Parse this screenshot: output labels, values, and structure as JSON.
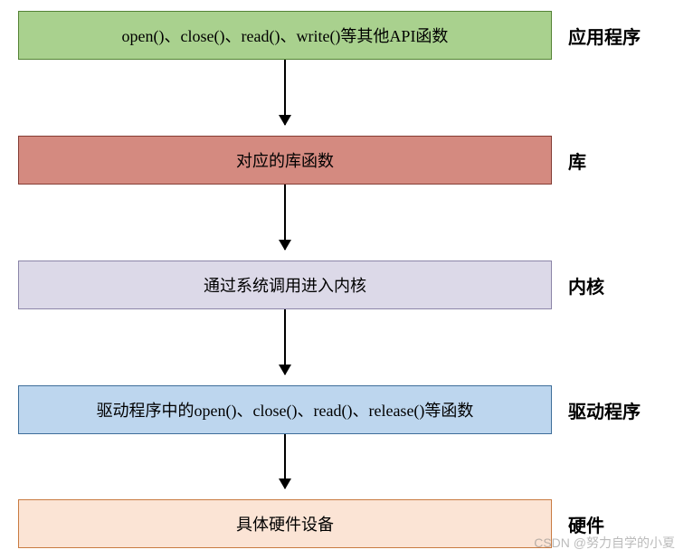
{
  "layers": [
    {
      "box_text": "open()、close()、read()、write()等其他API函数",
      "label": "应用程序"
    },
    {
      "box_text": "对应的库函数",
      "label": "库"
    },
    {
      "box_text": "通过系统调用进入内核",
      "label": "内核"
    },
    {
      "box_text": "驱动程序中的open()、close()、read()、release()等函数",
      "label": "驱动程序"
    },
    {
      "box_text": "具体硬件设备",
      "label": "硬件"
    }
  ],
  "watermark": "CSDN @努力自学的小夏"
}
